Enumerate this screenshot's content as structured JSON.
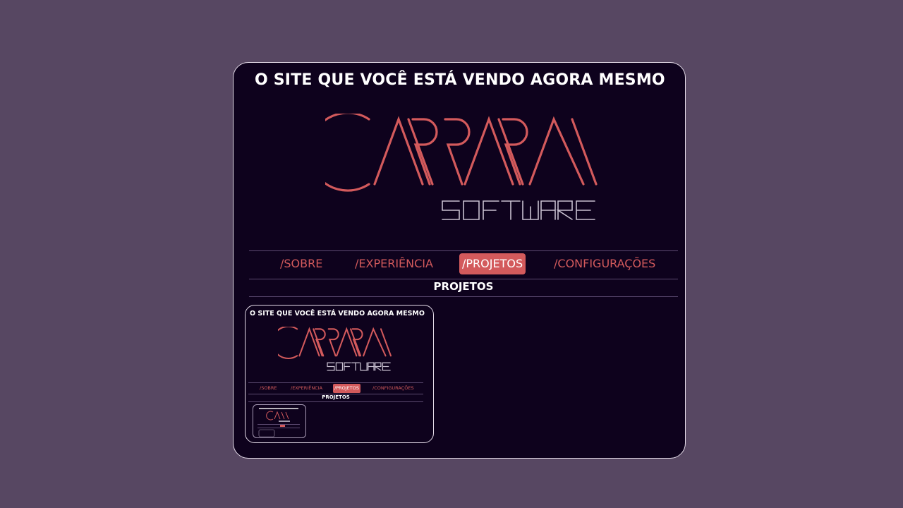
{
  "site": {
    "title": "O SITE QUE VOCÊ ESTÁ VENDO AGORA MESMO",
    "logo": {
      "primary": "CARRARA",
      "secondary": "SOFTWARE"
    }
  },
  "nav": {
    "items": [
      {
        "label": "/SOBRE",
        "active": false
      },
      {
        "label": "/EXPERIÊNCIA",
        "active": false
      },
      {
        "label": "/PROJETOS",
        "active": true
      },
      {
        "label": "/CONFIGURAÇÕES",
        "active": false
      }
    ]
  },
  "section": {
    "heading": "PROJETOS"
  },
  "projects": [
    {
      "title": "O SITE QUE VOCÊ ESTÁ VENDO AGORA MESMO"
    }
  ],
  "colors": {
    "background": "#574762",
    "panel": "#0e021d",
    "accent": "#d35a5c",
    "text": "#ffffff",
    "logo_secondary": "#c8c0d0"
  }
}
